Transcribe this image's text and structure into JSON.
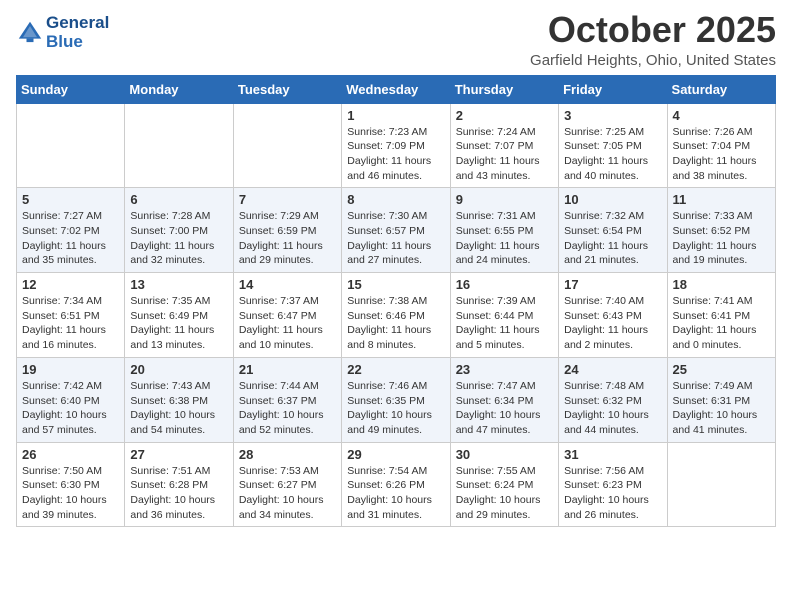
{
  "header": {
    "logo_line1": "General",
    "logo_line2": "Blue",
    "month": "October 2025",
    "location": "Garfield Heights, Ohio, United States"
  },
  "days_of_week": [
    "Sunday",
    "Monday",
    "Tuesday",
    "Wednesday",
    "Thursday",
    "Friday",
    "Saturday"
  ],
  "weeks": [
    [
      {
        "day": "",
        "sunrise": "",
        "sunset": "",
        "daylight": ""
      },
      {
        "day": "",
        "sunrise": "",
        "sunset": "",
        "daylight": ""
      },
      {
        "day": "",
        "sunrise": "",
        "sunset": "",
        "daylight": ""
      },
      {
        "day": "1",
        "sunrise": "Sunrise: 7:23 AM",
        "sunset": "Sunset: 7:09 PM",
        "daylight": "Daylight: 11 hours and 46 minutes."
      },
      {
        "day": "2",
        "sunrise": "Sunrise: 7:24 AM",
        "sunset": "Sunset: 7:07 PM",
        "daylight": "Daylight: 11 hours and 43 minutes."
      },
      {
        "day": "3",
        "sunrise": "Sunrise: 7:25 AM",
        "sunset": "Sunset: 7:05 PM",
        "daylight": "Daylight: 11 hours and 40 minutes."
      },
      {
        "day": "4",
        "sunrise": "Sunrise: 7:26 AM",
        "sunset": "Sunset: 7:04 PM",
        "daylight": "Daylight: 11 hours and 38 minutes."
      }
    ],
    [
      {
        "day": "5",
        "sunrise": "Sunrise: 7:27 AM",
        "sunset": "Sunset: 7:02 PM",
        "daylight": "Daylight: 11 hours and 35 minutes."
      },
      {
        "day": "6",
        "sunrise": "Sunrise: 7:28 AM",
        "sunset": "Sunset: 7:00 PM",
        "daylight": "Daylight: 11 hours and 32 minutes."
      },
      {
        "day": "7",
        "sunrise": "Sunrise: 7:29 AM",
        "sunset": "Sunset: 6:59 PM",
        "daylight": "Daylight: 11 hours and 29 minutes."
      },
      {
        "day": "8",
        "sunrise": "Sunrise: 7:30 AM",
        "sunset": "Sunset: 6:57 PM",
        "daylight": "Daylight: 11 hours and 27 minutes."
      },
      {
        "day": "9",
        "sunrise": "Sunrise: 7:31 AM",
        "sunset": "Sunset: 6:55 PM",
        "daylight": "Daylight: 11 hours and 24 minutes."
      },
      {
        "day": "10",
        "sunrise": "Sunrise: 7:32 AM",
        "sunset": "Sunset: 6:54 PM",
        "daylight": "Daylight: 11 hours and 21 minutes."
      },
      {
        "day": "11",
        "sunrise": "Sunrise: 7:33 AM",
        "sunset": "Sunset: 6:52 PM",
        "daylight": "Daylight: 11 hours and 19 minutes."
      }
    ],
    [
      {
        "day": "12",
        "sunrise": "Sunrise: 7:34 AM",
        "sunset": "Sunset: 6:51 PM",
        "daylight": "Daylight: 11 hours and 16 minutes."
      },
      {
        "day": "13",
        "sunrise": "Sunrise: 7:35 AM",
        "sunset": "Sunset: 6:49 PM",
        "daylight": "Daylight: 11 hours and 13 minutes."
      },
      {
        "day": "14",
        "sunrise": "Sunrise: 7:37 AM",
        "sunset": "Sunset: 6:47 PM",
        "daylight": "Daylight: 11 hours and 10 minutes."
      },
      {
        "day": "15",
        "sunrise": "Sunrise: 7:38 AM",
        "sunset": "Sunset: 6:46 PM",
        "daylight": "Daylight: 11 hours and 8 minutes."
      },
      {
        "day": "16",
        "sunrise": "Sunrise: 7:39 AM",
        "sunset": "Sunset: 6:44 PM",
        "daylight": "Daylight: 11 hours and 5 minutes."
      },
      {
        "day": "17",
        "sunrise": "Sunrise: 7:40 AM",
        "sunset": "Sunset: 6:43 PM",
        "daylight": "Daylight: 11 hours and 2 minutes."
      },
      {
        "day": "18",
        "sunrise": "Sunrise: 7:41 AM",
        "sunset": "Sunset: 6:41 PM",
        "daylight": "Daylight: 11 hours and 0 minutes."
      }
    ],
    [
      {
        "day": "19",
        "sunrise": "Sunrise: 7:42 AM",
        "sunset": "Sunset: 6:40 PM",
        "daylight": "Daylight: 10 hours and 57 minutes."
      },
      {
        "day": "20",
        "sunrise": "Sunrise: 7:43 AM",
        "sunset": "Sunset: 6:38 PM",
        "daylight": "Daylight: 10 hours and 54 minutes."
      },
      {
        "day": "21",
        "sunrise": "Sunrise: 7:44 AM",
        "sunset": "Sunset: 6:37 PM",
        "daylight": "Daylight: 10 hours and 52 minutes."
      },
      {
        "day": "22",
        "sunrise": "Sunrise: 7:46 AM",
        "sunset": "Sunset: 6:35 PM",
        "daylight": "Daylight: 10 hours and 49 minutes."
      },
      {
        "day": "23",
        "sunrise": "Sunrise: 7:47 AM",
        "sunset": "Sunset: 6:34 PM",
        "daylight": "Daylight: 10 hours and 47 minutes."
      },
      {
        "day": "24",
        "sunrise": "Sunrise: 7:48 AM",
        "sunset": "Sunset: 6:32 PM",
        "daylight": "Daylight: 10 hours and 44 minutes."
      },
      {
        "day": "25",
        "sunrise": "Sunrise: 7:49 AM",
        "sunset": "Sunset: 6:31 PM",
        "daylight": "Daylight: 10 hours and 41 minutes."
      }
    ],
    [
      {
        "day": "26",
        "sunrise": "Sunrise: 7:50 AM",
        "sunset": "Sunset: 6:30 PM",
        "daylight": "Daylight: 10 hours and 39 minutes."
      },
      {
        "day": "27",
        "sunrise": "Sunrise: 7:51 AM",
        "sunset": "Sunset: 6:28 PM",
        "daylight": "Daylight: 10 hours and 36 minutes."
      },
      {
        "day": "28",
        "sunrise": "Sunrise: 7:53 AM",
        "sunset": "Sunset: 6:27 PM",
        "daylight": "Daylight: 10 hours and 34 minutes."
      },
      {
        "day": "29",
        "sunrise": "Sunrise: 7:54 AM",
        "sunset": "Sunset: 6:26 PM",
        "daylight": "Daylight: 10 hours and 31 minutes."
      },
      {
        "day": "30",
        "sunrise": "Sunrise: 7:55 AM",
        "sunset": "Sunset: 6:24 PM",
        "daylight": "Daylight: 10 hours and 29 minutes."
      },
      {
        "day": "31",
        "sunrise": "Sunrise: 7:56 AM",
        "sunset": "Sunset: 6:23 PM",
        "daylight": "Daylight: 10 hours and 26 minutes."
      },
      {
        "day": "",
        "sunrise": "",
        "sunset": "",
        "daylight": ""
      }
    ]
  ]
}
